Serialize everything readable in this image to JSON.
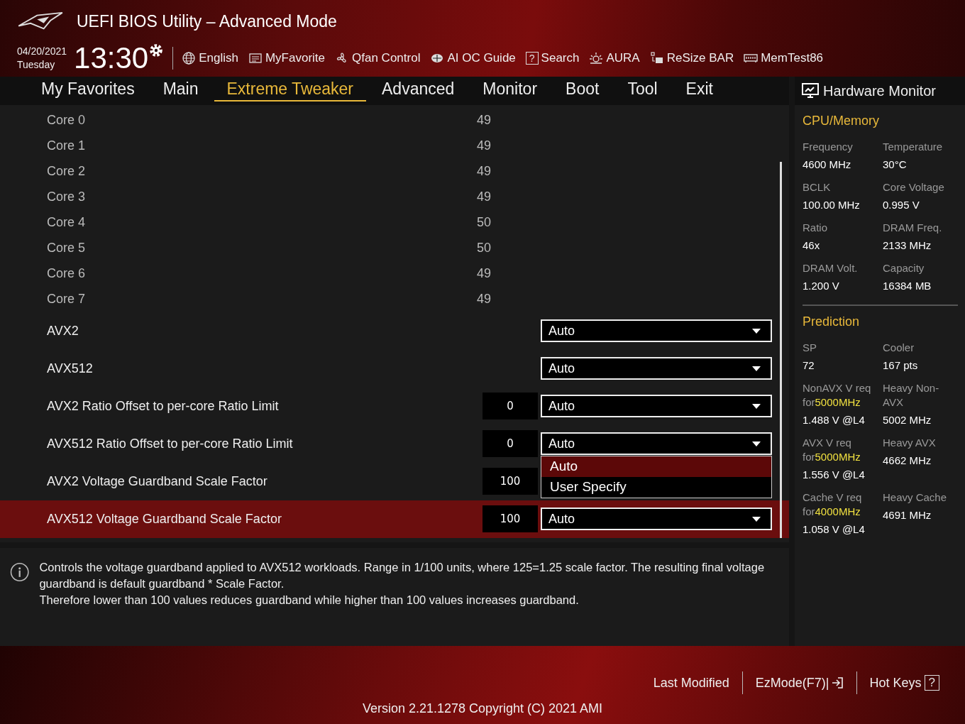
{
  "header": {
    "title": "UEFI BIOS Utility – Advanced Mode",
    "date": "04/20/2021",
    "day": "Tuesday",
    "time": "13:30",
    "tools": [
      {
        "kind": "globe",
        "label": "English"
      },
      {
        "kind": "list",
        "label": "MyFavorite"
      },
      {
        "kind": "fan",
        "label": "Qfan Control"
      },
      {
        "kind": "chip",
        "label": "AI OC Guide"
      },
      {
        "kind": "help",
        "label": "Search",
        "icon": "?"
      },
      {
        "kind": "sun",
        "label": "AURA"
      },
      {
        "kind": "resize",
        "label": "ReSize BAR"
      },
      {
        "kind": "memory",
        "label": "MemTest86"
      }
    ]
  },
  "tabs": [
    {
      "label": "My Favorites",
      "selected": false
    },
    {
      "label": "Main",
      "selected": false
    },
    {
      "label": "Extreme Tweaker",
      "selected": true
    },
    {
      "label": "Advanced",
      "selected": false
    },
    {
      "label": "Monitor",
      "selected": false
    },
    {
      "label": "Boot",
      "selected": false
    },
    {
      "label": "Tool",
      "selected": false
    },
    {
      "label": "Exit",
      "selected": false
    }
  ],
  "settings": [
    {
      "kind": "value",
      "label": "Core 0",
      "value": "49",
      "selected": false
    },
    {
      "kind": "value",
      "label": "Core 1",
      "value": "49",
      "selected": false
    },
    {
      "kind": "value",
      "label": "Core 2",
      "value": "49",
      "selected": false
    },
    {
      "kind": "value",
      "label": "Core 3",
      "value": "49",
      "selected": false
    },
    {
      "kind": "value",
      "label": "Core 4",
      "value": "50",
      "selected": false
    },
    {
      "kind": "value",
      "label": "Core 5",
      "value": "50",
      "selected": false
    },
    {
      "kind": "value",
      "label": "Core 6",
      "value": "49",
      "selected": false
    },
    {
      "kind": "value",
      "label": "Core 7",
      "value": "49",
      "selected": false
    },
    {
      "kind": "select",
      "label": "AVX2",
      "value": "Auto",
      "selected": false
    },
    {
      "kind": "select",
      "label": "AVX512",
      "value": "Auto",
      "selected": false
    },
    {
      "kind": "select",
      "label": "AVX2 Ratio Offset to per-core Ratio Limit",
      "number": "0",
      "value": "Auto",
      "selected": false
    },
    {
      "kind": "select",
      "label": "AVX512 Ratio Offset to per-core Ratio Limit",
      "number": "0",
      "value": "Auto",
      "selected": false,
      "options": [
        {
          "label": "Auto",
          "selected": true
        },
        {
          "label": "User Specify",
          "selected": false
        }
      ]
    },
    {
      "kind": "select",
      "label": "AVX2 Voltage Guardband Scale Factor",
      "number": "100",
      "selected": false
    },
    {
      "kind": "select",
      "label": "AVX512 Voltage Guardband Scale Factor",
      "number": "100",
      "value": "Auto",
      "selected": true
    }
  ],
  "help": {
    "lines": [
      "Controls the voltage guardband applied to AVX512 workloads. Range in 1/100 units, where 125=1.25 scale factor. The resulting final voltage guardband is default guardband * Scale Factor.",
      "Therefore lower than 100 values reduces guardband while higher than 100 values increases guardband."
    ]
  },
  "hardware_monitor": {
    "title": "Hardware Monitor",
    "sections": [
      {
        "title": "CPU/Memory",
        "items": [
          {
            "label": "Frequency",
            "value": "4600 MHz"
          },
          {
            "label": "Temperature",
            "value": "30°C"
          },
          {
            "label": "BCLK",
            "value": "100.00 MHz"
          },
          {
            "label": "Core Voltage",
            "value": "0.995 V"
          },
          {
            "label": "Ratio",
            "value": "46x"
          },
          {
            "label": "DRAM Freq.",
            "value": "2133 MHz"
          },
          {
            "label": "DRAM Volt.",
            "value": "1.200 V"
          },
          {
            "label": "Capacity",
            "value": "16384 MB"
          }
        ]
      },
      {
        "title": "Prediction",
        "items": [
          {
            "label": "SP",
            "value": "72"
          },
          {
            "label": "Cooler",
            "value": "167 pts"
          },
          {
            "label": "NonAVX V req for",
            "highlight": "5000MHz",
            "value": "1.488 V @L4"
          },
          {
            "label": "Heavy Non-AVX",
            "value": "5002 MHz"
          },
          {
            "label": "AVX V req    for",
            "highlight": "5000MHz",
            "value": "1.556 V @L4"
          },
          {
            "label": "Heavy AVX",
            "value": "4662 MHz"
          },
          {
            "label": "Cache V req for",
            "highlight": "4000MHz",
            "value": "1.058 V @L4"
          },
          {
            "label": "Heavy Cache",
            "value": "4691 MHz"
          }
        ]
      }
    ]
  },
  "footer": {
    "buttons": [
      {
        "kind": "plain",
        "label": "Last Modified"
      },
      {
        "kind": "exit",
        "label": "EzMode(F7)|"
      },
      {
        "kind": "help",
        "label": "Hot Keys",
        "icon": "?"
      }
    ],
    "version": "Version 2.21.1278 Copyright (C) 2021 AMI"
  }
}
